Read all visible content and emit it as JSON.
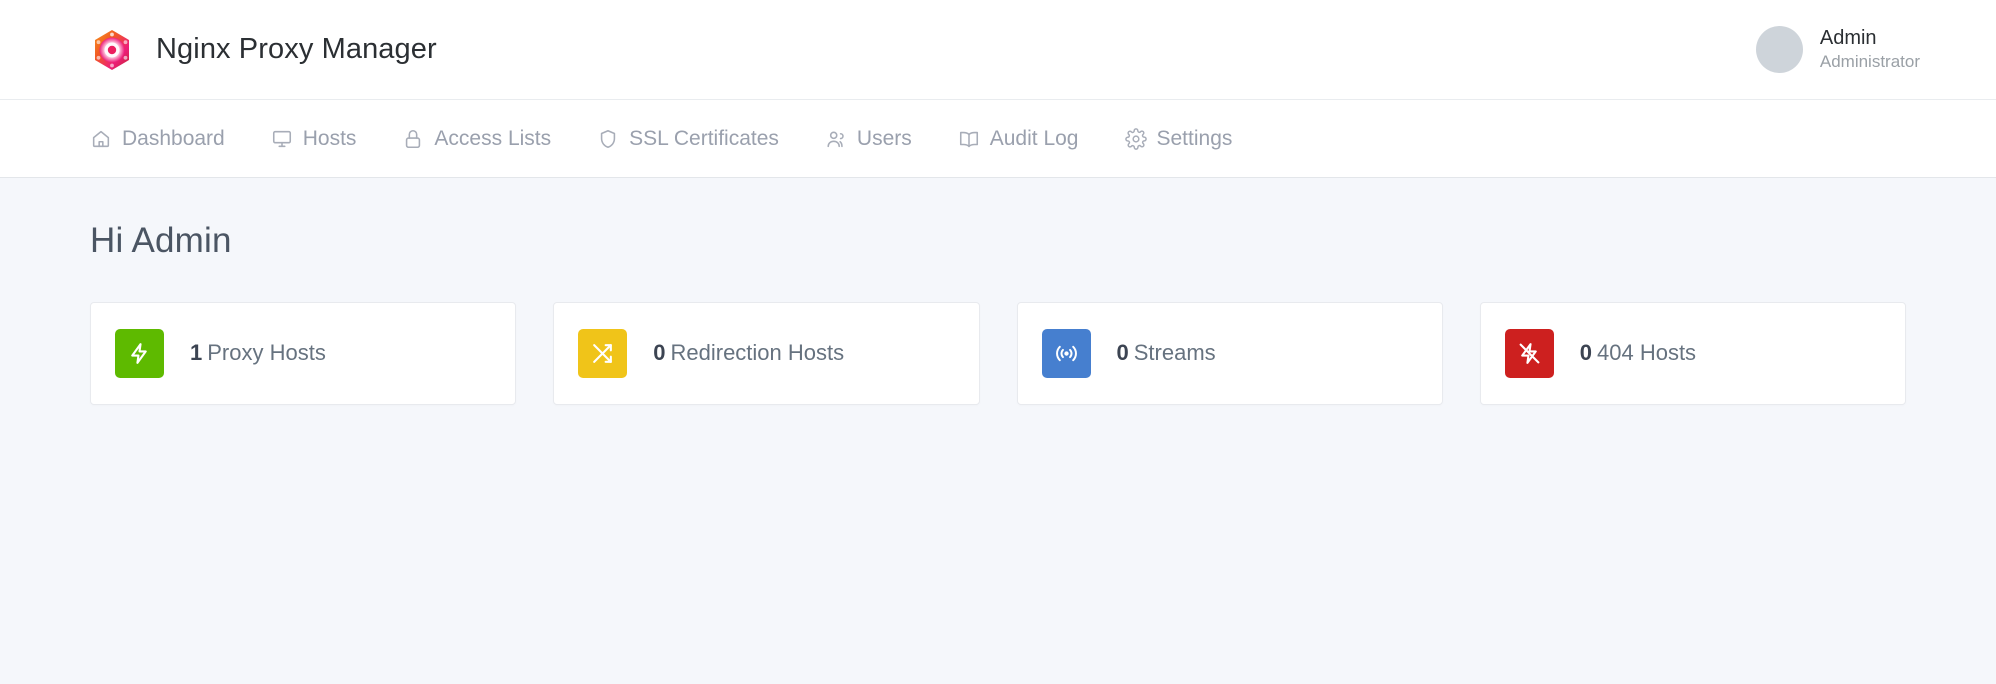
{
  "header": {
    "brand_title": "Nginx Proxy Manager",
    "logo_icon": "npm-hexagon-logo-icon",
    "account": {
      "name": "Admin",
      "role": "Administrator",
      "avatar_icon": "avatar-placeholder-icon"
    }
  },
  "nav": {
    "items": [
      {
        "label": "Dashboard",
        "icon": "home-icon",
        "active": true
      },
      {
        "label": "Hosts",
        "icon": "monitor-icon",
        "active": false
      },
      {
        "label": "Access Lists",
        "icon": "lock-icon",
        "active": false
      },
      {
        "label": "SSL Certificates",
        "icon": "shield-icon",
        "active": false
      },
      {
        "label": "Users",
        "icon": "users-icon",
        "active": false
      },
      {
        "label": "Audit Log",
        "icon": "book-icon",
        "active": false
      },
      {
        "label": "Settings",
        "icon": "gear-icon",
        "active": false
      }
    ]
  },
  "main": {
    "page_title": "Hi Admin",
    "stats": [
      {
        "count": "1",
        "label": "Proxy Hosts",
        "icon": "lightning-bolt-icon",
        "color": "#5eba00"
      },
      {
        "count": "0",
        "label": "Redirection Hosts",
        "icon": "shuffle-arrows-icon",
        "color": "#f0c419"
      },
      {
        "count": "0",
        "label": "Streams",
        "icon": "broadcast-waves-icon",
        "color": "#467fcf"
      },
      {
        "count": "0",
        "label": "404 Hosts",
        "icon": "lightning-bolt-off-icon",
        "color": "#cd201f"
      }
    ]
  },
  "theme": {
    "page_background": "#f5f7fb",
    "surface": "#ffffff",
    "border": "#e8eaee",
    "text_primary": "#3c4452",
    "text_muted": "#9aa0ad"
  }
}
